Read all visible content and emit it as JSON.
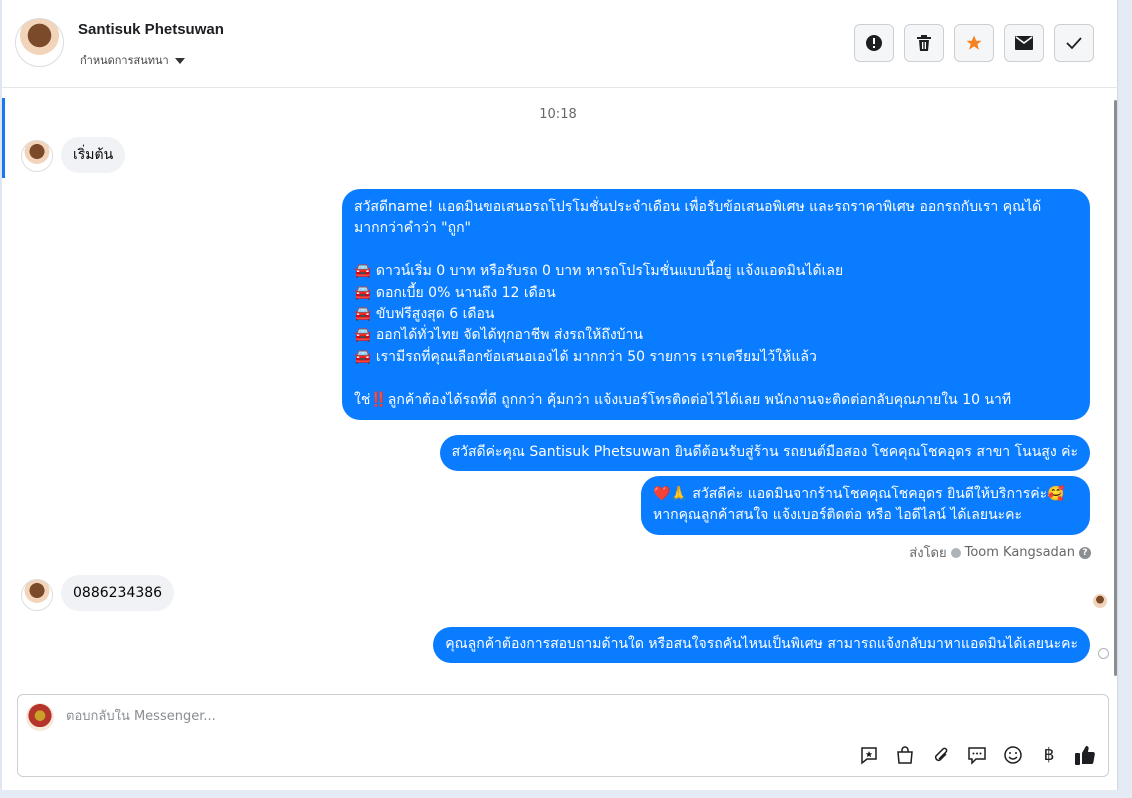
{
  "header": {
    "contact_name": "Santisuk Phetsuwan",
    "label_dropdown": "กำหนดการสนทนา",
    "actions": [
      {
        "icon": "alert-icon",
        "name": "report"
      },
      {
        "icon": "trash-icon",
        "name": "delete"
      },
      {
        "icon": "star-icon",
        "name": "star"
      },
      {
        "icon": "envelope-icon",
        "name": "mark-unread"
      },
      {
        "icon": "check-icon",
        "name": "mark-done"
      }
    ],
    "star_color": "#f5821f"
  },
  "conversation": {
    "timestamp": "10:18",
    "messages": [
      {
        "from": "customer",
        "text": "เริ่มต้น"
      },
      {
        "from": "page",
        "text": "สวัสดีname! แอดมินขอเสนอรถโปรโมชั่นประจำเดือน เพื่อรับข้อเสนอพิเศษ และรถราคาพิเศษ ออกรถกับเรา คุณได้มากกว่าคำว่า \"ถูก\"\n\n🚘 ดาวน์เริ่ม 0 บาท หรือรับรถ 0 บาท หารถโปรโมชั่นแบบนี้อยู่ แจ้งแอดมินได้เลย\n🚘 ดอกเบี้ย 0% นานถึง 12 เดือน\n🚘 ขับฟรีสูงสุด 6 เดือน\n🚘 ออกได้ทั่วไทย จัดได้ทุกอาชีพ ส่งรถให้ถึงบ้าน\n🚘 เรามีรถที่คุณเลือกข้อเสนอเองได้ มากกว่า 50 รายการ เราเตรียมไว้ให้แล้ว\n\nใช่‼️ลูกค้าต้องได้รถที่ดี ถูกกว่า คุ้มกว่า แจ้งเบอร์โทรติดต่อไว้ได้เลย พนักงานจะติดต่อกลับคุณภายใน 10 นาที"
      },
      {
        "from": "page",
        "text": "สวัสดีค่ะคุณ Santisuk Phetsuwan ยินดีต้อนรับสู่ร้าน รถยนต์มือสอง โชคคุณโชคอุดร สาขา โนนสูง ค่ะ"
      },
      {
        "from": "page",
        "text": "❤️🙏 สวัสดีค่ะ แอดมินจากร้านโชคคุณโชคอุดร ยินดีให้บริการค่ะ🥰\nหากคุณลูกค้าสนใจ แจ้งเบอร์ติดต่อ หรือ ไอดีไลน์ ได้เลยนะคะ"
      },
      {
        "from": "customer",
        "text": "0886234386"
      },
      {
        "from": "page",
        "text": "คุณลูกค้าต้องการสอบถามด้านใด หรือสนใจรถคันไหนเป็นพิเศษ สามารถแจ้งกลับมาหาแอดมินได้เลยนะคะ"
      }
    ],
    "sent_by_prefix": "ส่งโดย",
    "sent_by_name": "Toom Kangsadan"
  },
  "composer": {
    "placeholder": "ตอบกลับใน Messenger...",
    "value": "",
    "tools": [
      "saved-reply-icon",
      "shop-icon",
      "attachment-icon",
      "chat-bubble-icon",
      "emoji-icon",
      "baht-icon",
      "thumbs-up-icon"
    ]
  },
  "colors": {
    "accent": "#1877f2",
    "outgoing_bubble": "#0a7cff",
    "incoming_bubble": "#f0f2f5"
  }
}
